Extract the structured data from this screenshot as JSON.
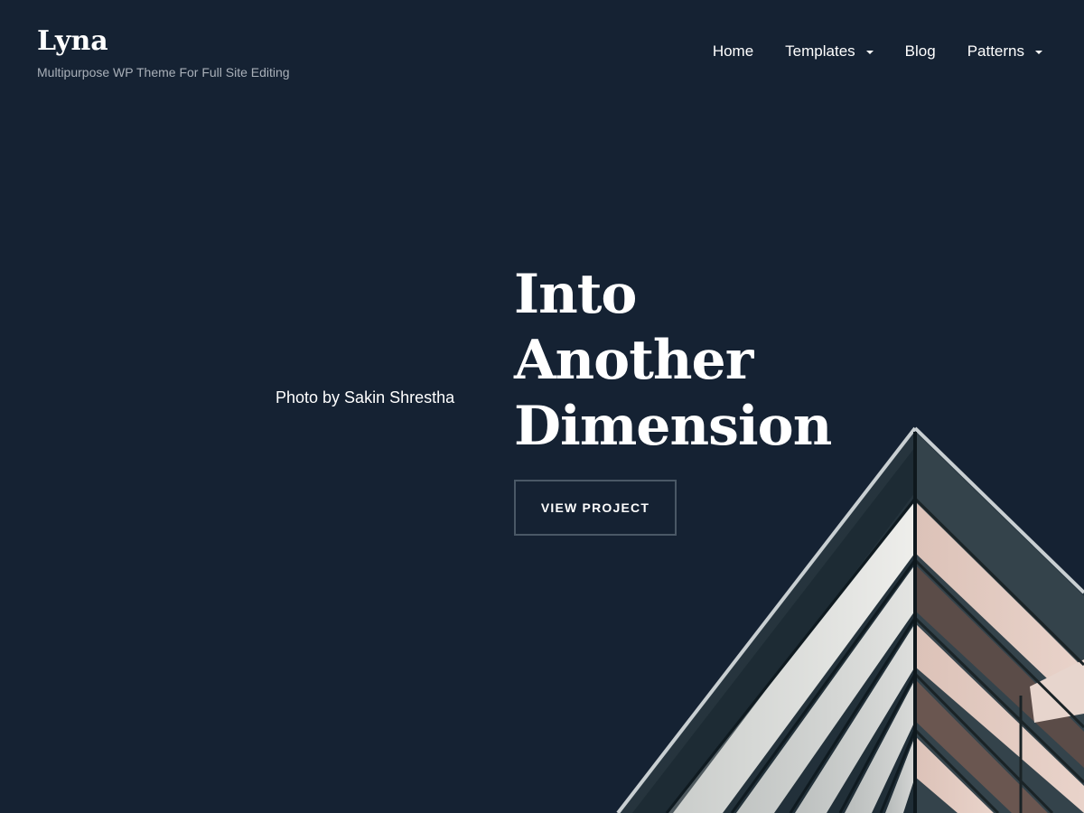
{
  "header": {
    "site_title": "Lyna",
    "tagline": "Multipurpose WP Theme For Full Site Editing"
  },
  "nav": {
    "items": [
      {
        "label": "Home",
        "has_dropdown": false
      },
      {
        "label": "Templates",
        "has_dropdown": true
      },
      {
        "label": "Blog",
        "has_dropdown": false
      },
      {
        "label": "Patterns",
        "has_dropdown": true
      }
    ]
  },
  "hero": {
    "photo_credit": "Photo by Sakin Shrestha",
    "title_lines": [
      "Into",
      "Another",
      "Dimension"
    ],
    "button_label": "VIEW PROJECT"
  },
  "colors": {
    "background": "#152233",
    "text": "#ffffff",
    "tagline": "#a9b0b9",
    "button_border": "#4a5866"
  }
}
